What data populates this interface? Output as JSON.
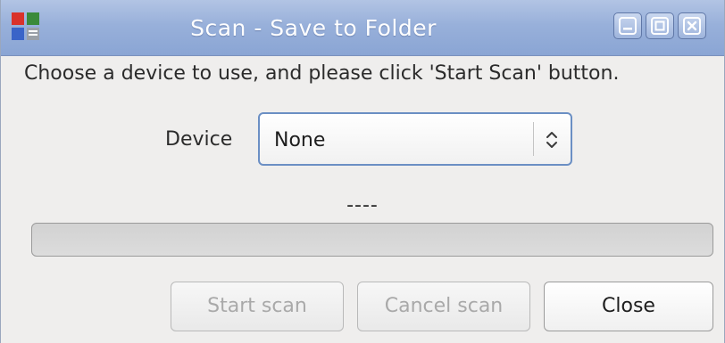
{
  "window": {
    "title": "Scan - Save to Folder",
    "icon": "scanner-app-icon",
    "controls": [
      "minimize-icon",
      "maximize-icon",
      "close-icon"
    ]
  },
  "instruction": "Choose a device to use, and please click 'Start Scan' button.",
  "device": {
    "label": "Device",
    "selected": "None"
  },
  "status": {
    "text": "----",
    "progress": 0
  },
  "buttons": {
    "start": "Start scan",
    "cancel": "Cancel scan",
    "close": "Close"
  },
  "colors": {
    "titlebar": "#98b0da",
    "focus_border": "#6b8fc4",
    "disabled_text": "#a9a9a9"
  }
}
